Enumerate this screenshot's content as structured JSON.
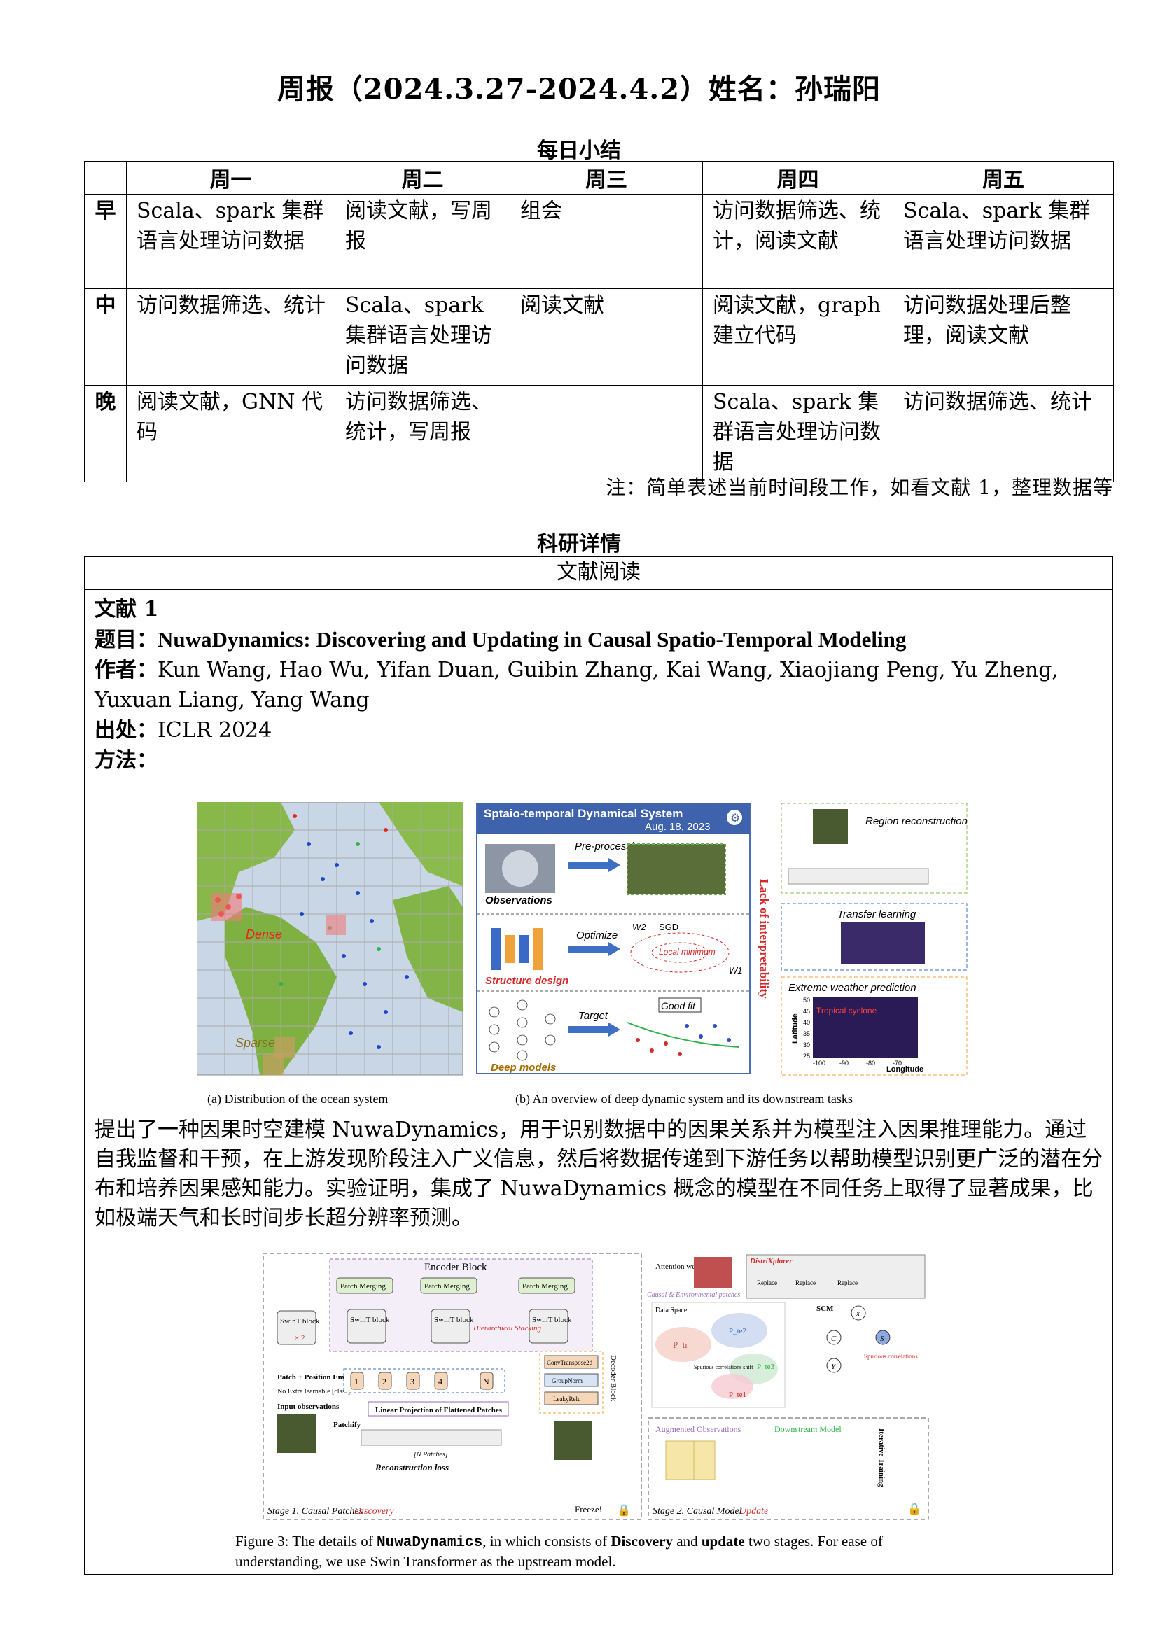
{
  "header": {
    "title": "周报（2024.3.27-2024.4.2）姓名：孙瑞阳"
  },
  "daily": {
    "section_title": "每日小结",
    "columns": [
      "周一",
      "周二",
      "周三",
      "周四",
      "周五"
    ],
    "rows": [
      {
        "label": "早",
        "cells": [
          "Scala、spark 集群语言处理访问数据",
          "阅读文献，写周报",
          "组会",
          "访问数据筛选、统计，阅读文献",
          "Scala、spark 集群语言处理访问数据"
        ]
      },
      {
        "label": "中",
        "cells": [
          "访问数据筛选、统计",
          "Scala、spark 集群语言处理访问数据",
          "阅读文献",
          "阅读文献，graph 建立代码",
          "访问数据处理后整理，阅读文献"
        ]
      },
      {
        "label": "晚",
        "cells": [
          "阅读文献，GNN 代码",
          "访问数据筛选、统计，写周报",
          "",
          "Scala、spark 集群语言处理访问数据",
          "访问数据筛选、统计"
        ]
      }
    ],
    "note": "注：简单表述当前时间段工作，如看文献 1，整理数据等"
  },
  "research": {
    "section_title": "科研详情",
    "box_header": "文献阅读",
    "paper_heading": "文献 1",
    "title_label": "题目：",
    "title": "NuwaDynamics: Discovering and Updating in Causal Spatio-Temporal Modeling",
    "authors_label": "作者：",
    "authors": "Kun Wang, Hao Wu, Yifan Duan, Guibin Zhang, Kai Wang, Xiaojiang Peng, Yu Zheng, Yuxuan Liang, Yang Wang",
    "source_label": "出处：",
    "source": "ICLR 2024",
    "method_label": "方法：",
    "summary": "提出了一种因果时空建模 NuwaDynamics，用于识别数据中的因果关系并为模型注入因果推理能力。通过自我监督和干预，在上游发现阶段注入广义信息，然后将数据传递到下游任务以帮助模型识别更广泛的潜在分布和培养因果感知能力。实验证明，集成了 NuwaDynamics 概念的模型在不同任务上取得了显著成果，比如极端天气和长时间步长超分辨率预测。"
  },
  "figure1": {
    "caption_a": "(a) Distribution of the ocean system",
    "caption_b": "(b) An overview of deep dynamic system and its downstream tasks",
    "label_dense": "Dense",
    "label_sparse": "Sparse",
    "system_title": "Sptaio-temporal Dynamical System",
    "system_date": "Aug. 18, 2023",
    "observations": "Observations",
    "preprocessing": "Pre-processing",
    "optimize": "Optimize",
    "structure_design": "Structure design",
    "target": "Target",
    "good_fit": "Good fit",
    "deep_models": "Deep models",
    "sgd": "SGD",
    "local_minimum": "Local minimum",
    "w1": "W1",
    "w2": "W2",
    "lack": "Lack of interpretability",
    "region_reconstruction": "Region reconstruction",
    "transfer_learning": "Transfer learning",
    "extreme_weather": "Extreme weather prediction",
    "tropical_cyclone": "Tropical cyclone",
    "latitude": "Latitude",
    "longitude": "Longitude",
    "lat_ticks": [
      "50",
      "45",
      "40",
      "35",
      "30",
      "25"
    ],
    "lon_ticks": [
      "-100",
      "-90",
      "-80",
      "-70"
    ]
  },
  "figure2": {
    "encoder_block": "Encoder Block",
    "patch_merging": "Patch Merging",
    "swint_block": "SwinT block",
    "times2": "× 2",
    "hierarchical": "Hierarchical Stacking",
    "patch_pos": "Patch + Position Embedding",
    "no_extra": "No Extra learnable [class] token",
    "input_obs": "Input observations",
    "patchify": "Patchify",
    "n_patches": "[N Patches]",
    "linear_proj": "Linear Projection of Flattened Patches",
    "recon_loss": "Reconstruction loss",
    "stage1": "Stage 1. Causal Patches",
    "discovery": "Discovery",
    "freeze": "Freeze!",
    "conv_t": "ConvTranspose2d",
    "group_norm": "GroupNorm",
    "leaky_relu": "LeakyRelu",
    "decoder_block": "Decoder Block",
    "patch_nums": [
      "1",
      "2",
      "3",
      "4",
      "N"
    ],
    "attention_weight": "Attention weight",
    "causal_env": "Causal & Environmental patches",
    "distrixplorer": "DistriXplorer",
    "replace": "Replace",
    "data_space": "Data Space",
    "p_tr": "P_tr",
    "p_te1": "P_te1",
    "p_te2": "P_te2",
    "p_te3": "P_te3",
    "spurious_shift": "Spurious correlations shift",
    "scm": "SCM",
    "node_x": "X",
    "node_c": "C",
    "node_s": "S",
    "node_y": "Y",
    "spurious_corr": "Spurious correlations",
    "augmented": "Augmented Observations",
    "downstream": "Downstream Model",
    "iterative": "Iterative Training",
    "stage2": "Stage 2. Causal Model",
    "update": "Update",
    "caption_pre": "Figure 3: The details of ",
    "caption_name": "NuwaDynamics",
    "caption_mid": ", in which consists of ",
    "caption_disc": "Discovery",
    "caption_and": " and ",
    "caption_upd": "update",
    "caption_post": " two stages. For ease of understanding, we use Swin Transformer as the upstream model."
  }
}
